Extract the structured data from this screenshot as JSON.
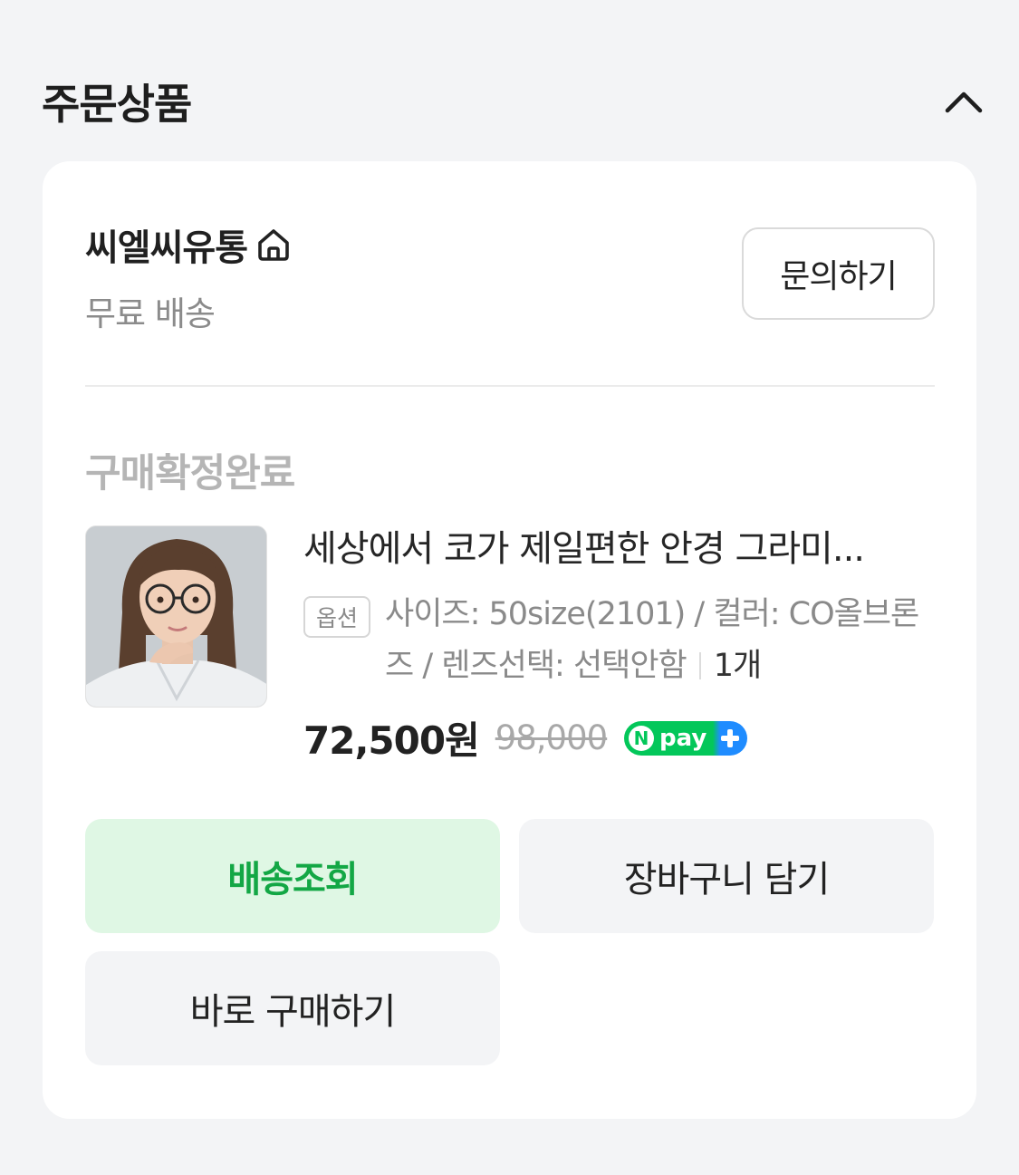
{
  "section": {
    "title": "주문상품",
    "collapse_icon": "chevron-up-icon"
  },
  "seller": {
    "name": "씨엘씨유통",
    "store_icon": "home-icon",
    "shipping": "무료 배송",
    "inquiry_label": "문의하기"
  },
  "order": {
    "status": "구매확정완료",
    "product": {
      "image_icon": "product-photo",
      "title": "세상에서 코가 제일편한 안경 그라미...",
      "option_badge": "옵션",
      "option_text": "사이즈: 50size(2101) / 컬러: CO올브론즈 / 렌즈선택: 선택안함",
      "quantity": "1개",
      "sale_price": "72,500원",
      "original_price": "98,000",
      "npay_badge": "Npay+",
      "npay_text": "pay"
    }
  },
  "actions": {
    "track_label": "배송조회",
    "cart_label": "장바구니 담기",
    "buy_label": "바로 구매하기"
  },
  "colors": {
    "accent_green": "#13a745",
    "track_bg": "#dff7e4",
    "npay_green": "#03c75a",
    "npay_blue": "#1f8cff"
  }
}
